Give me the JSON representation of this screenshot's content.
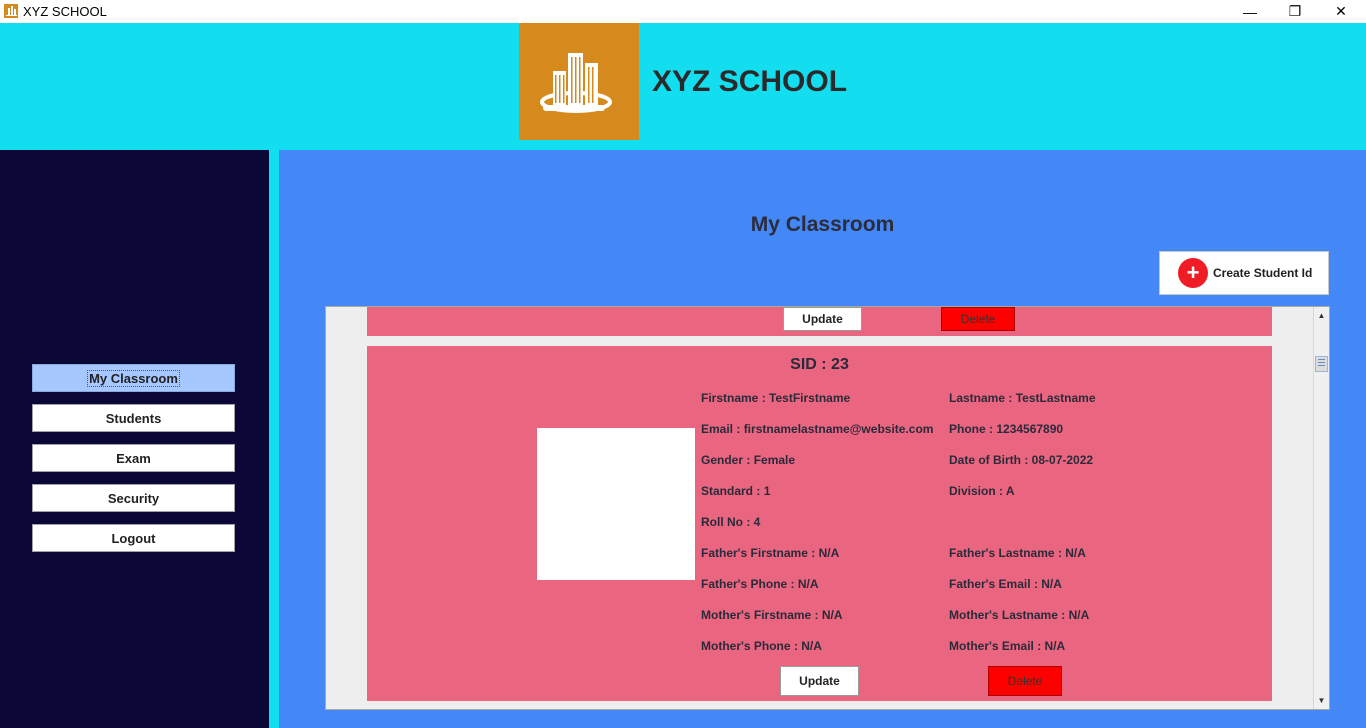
{
  "window": {
    "title": "XYZ SCHOOL",
    "icon": "school-building-icon",
    "controls": {
      "minimize": "—",
      "restore": "❐",
      "close": "✕"
    }
  },
  "header": {
    "school_name": "XYZ SCHOOL",
    "logo_icon": "school-building-icon",
    "background": "#13def0",
    "logo_background": "#d6891d"
  },
  "sidebar": {
    "items": [
      {
        "label": "My Classroom",
        "active": true
      },
      {
        "label": "Students"
      },
      {
        "label": "Exam"
      },
      {
        "label": "Security"
      },
      {
        "label": "Logout"
      }
    ]
  },
  "main": {
    "page_title": "My Classroom",
    "create_button": {
      "label": "Create Student Id",
      "icon": "plus-circle-icon"
    }
  },
  "cards": {
    "top_partial": {
      "update_label": "Update",
      "delete_label": "Delete"
    },
    "student": {
      "sid_label": "SID : 23",
      "fields": [
        {
          "label": "Firstname",
          "value": "TestFirstname"
        },
        {
          "label": "Lastname",
          "value": "TestLastname"
        },
        {
          "label": "Email",
          "value": "firstnamelastname@website.com"
        },
        {
          "label": "Phone",
          "value": "1234567890"
        },
        {
          "label": "Gender",
          "value": "Female"
        },
        {
          "label": "Date of Birth",
          "value": "08-07-2022"
        },
        {
          "label": "Standard",
          "value": "1"
        },
        {
          "label": "Division",
          "value": "A"
        },
        {
          "label": "Roll No",
          "value": "4"
        },
        {
          "label": "Father's Firstname",
          "value": "N/A"
        },
        {
          "label": "Father's Lastname",
          "value": "N/A"
        },
        {
          "label": "Father's Phone",
          "value": "N/A"
        },
        {
          "label": "Father's Email",
          "value": "N/A"
        },
        {
          "label": "Mother's Firstname",
          "value": "N/A"
        },
        {
          "label": "Mother's Lastname",
          "value": "N/A"
        },
        {
          "label": "Mother's Phone",
          "value": "N/A"
        },
        {
          "label": "Mother's Email",
          "value": "N/A"
        }
      ],
      "update_label": "Update",
      "delete_label": "Delete"
    }
  },
  "colors": {
    "sidebar": "#0b0838",
    "main": "#4487f6",
    "card": "#ea6680",
    "delete": "#fe0000",
    "active_nav": "#a6c8ff"
  }
}
